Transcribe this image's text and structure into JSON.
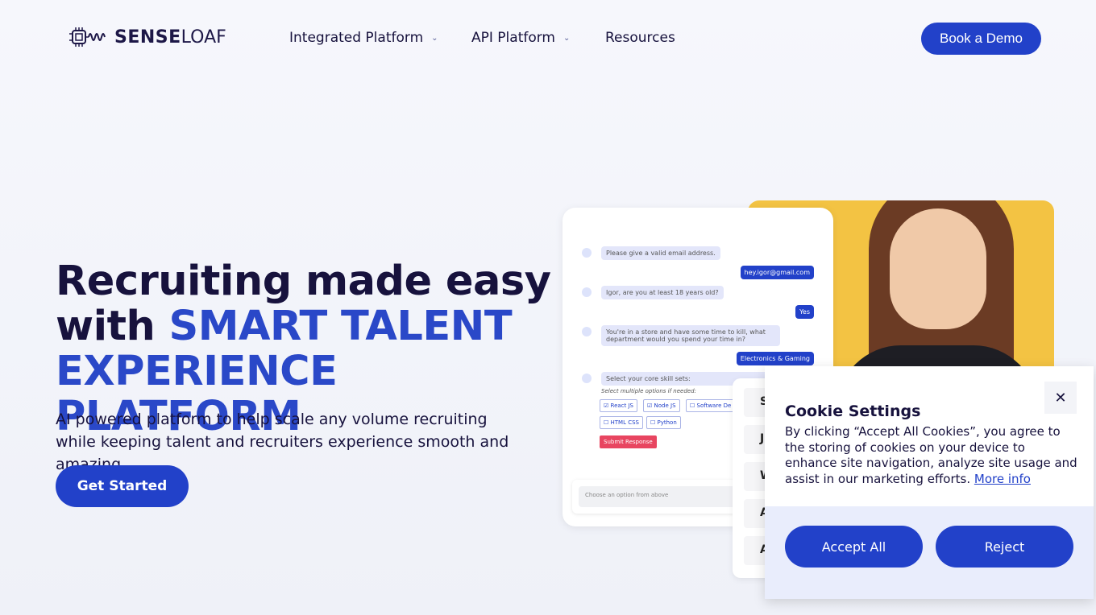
{
  "nav": {
    "logo_bold": "SENSE",
    "logo_light": "LOAF",
    "items": [
      {
        "label": "Integrated Platform",
        "dropdown": true
      },
      {
        "label": "API Platform",
        "dropdown": true
      },
      {
        "label": "Resources",
        "dropdown": false
      }
    ],
    "cta": "Book a Demo"
  },
  "hero": {
    "title_line1": "Recruiting made easy",
    "title_with": "with ",
    "title_accent1": "SMART TALENT",
    "title_accent2": "EXPERIENCE PLATFORM",
    "subtitle": "AI powered platform to help scale any volume recruiting while keeping talent and recruiters experience smooth and amazing",
    "cta": "Get Started",
    "accent_color": "#2a48c8"
  },
  "chat": {
    "messages": [
      {
        "from": "bot",
        "text": "Please give a valid email address."
      },
      {
        "from": "user",
        "text": "hey.igor@gmail.com"
      },
      {
        "from": "bot",
        "text": "Igor, are you at least 18 years old?"
      },
      {
        "from": "user",
        "text": "Yes"
      },
      {
        "from": "bot",
        "text": "You're in a store and have some time to kill, what department would you spend your time in?"
      },
      {
        "from": "user",
        "text": "Electronics & Gaming"
      },
      {
        "from": "bot",
        "text": "Select your core skill sets:"
      }
    ],
    "hint": "Select multiple options if needed:",
    "options": [
      {
        "label": "React JS",
        "checked": true
      },
      {
        "label": "Node JS",
        "checked": true
      },
      {
        "label": "Software De",
        "checked": false
      },
      {
        "label": "HTML CSS",
        "checked": false
      },
      {
        "label": "Python",
        "checked": false
      }
    ],
    "submit": "Submit Response",
    "input_placeholder": "Choose an option from above"
  },
  "side_letters": [
    "S",
    "J",
    "W",
    "A",
    "A"
  ],
  "cookie": {
    "title": "Cookie Settings",
    "body": "By clicking “Accept All Cookies”, you agree to the storing of cookies on your device to enhance site navigation, analyze site usage and assist in our marketing efforts.",
    "more": "More info",
    "accept": "Accept All",
    "reject": "Reject",
    "close": "✕"
  }
}
